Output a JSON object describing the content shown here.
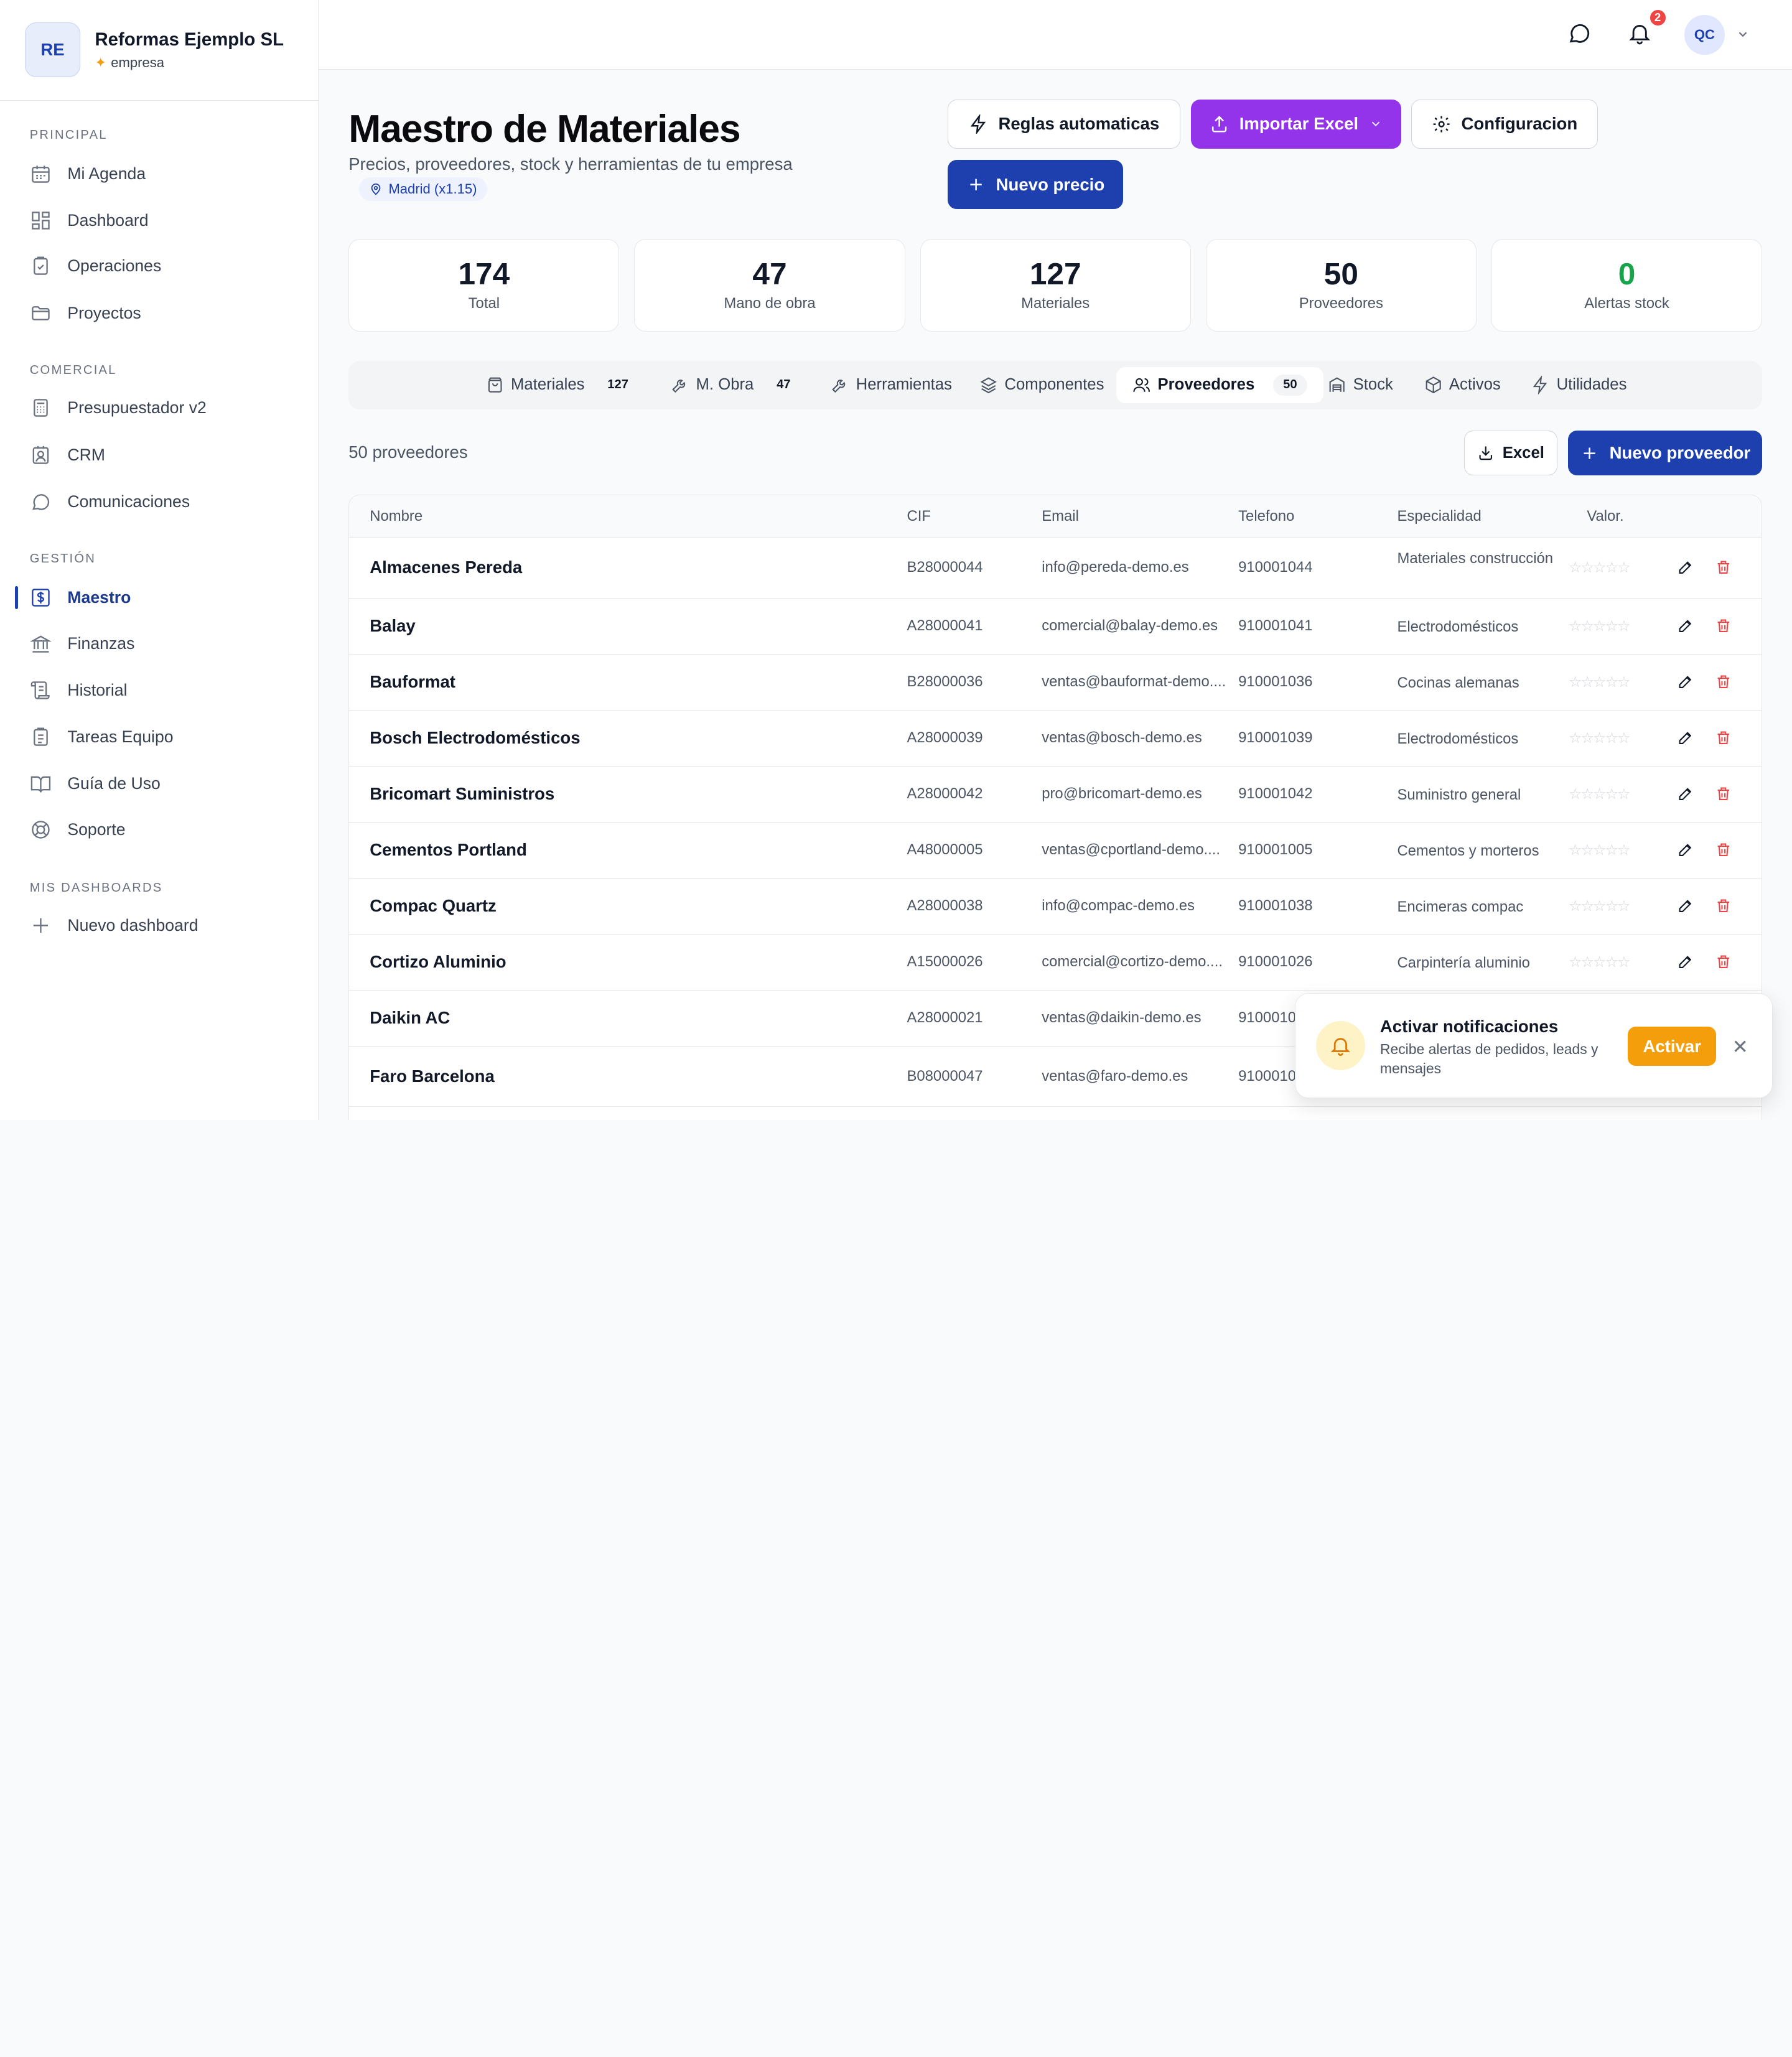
{
  "brand": {
    "initials": "RE",
    "name": "Reformas Ejemplo SL",
    "type": "empresa"
  },
  "sidebar": {
    "sections": [
      {
        "title": "PRINCIPAL",
        "items": [
          {
            "label": "Mi Agenda",
            "icon": "calendar-icon"
          },
          {
            "label": "Dashboard",
            "icon": "dashboard-icon"
          },
          {
            "label": "Operaciones",
            "icon": "clipboard-check-icon"
          },
          {
            "label": "Proyectos",
            "icon": "folder-icon"
          }
        ]
      },
      {
        "title": "COMERCIAL",
        "items": [
          {
            "label": "Presupuestador v2",
            "icon": "calculator-icon"
          },
          {
            "label": "CRM",
            "icon": "contact-icon"
          },
          {
            "label": "Comunicaciones",
            "icon": "message-icon"
          }
        ]
      },
      {
        "title": "GESTIÓN",
        "items": [
          {
            "label": "Maestro",
            "icon": "dollar-square-icon",
            "active": true
          },
          {
            "label": "Finanzas",
            "icon": "bank-icon"
          },
          {
            "label": "Historial",
            "icon": "scroll-icon"
          },
          {
            "label": "Tareas Equipo",
            "icon": "clipboard-list-icon"
          },
          {
            "label": "Guía de Uso",
            "icon": "book-icon"
          },
          {
            "label": "Soporte",
            "icon": "lifebuoy-icon"
          }
        ]
      },
      {
        "title": "MIS DASHBOARDS",
        "items": [
          {
            "label": "Nuevo dashboard",
            "icon": "plus-icon"
          }
        ]
      }
    ]
  },
  "topbar": {
    "notification_count": "2",
    "user_initials": "QC"
  },
  "page": {
    "title": "Maestro de Materiales",
    "subtitle": "Precios, proveedores, stock y herramientas de tu empresa",
    "region": "Madrid (x1.15)",
    "buttons": {
      "rules": "Reglas automaticas",
      "import": "Importar Excel",
      "config": "Configuracion",
      "new_price": "Nuevo precio"
    }
  },
  "stats": [
    {
      "value": "174",
      "label": "Total",
      "color": "#111827"
    },
    {
      "value": "47",
      "label": "Mano de obra",
      "color": "#111827"
    },
    {
      "value": "127",
      "label": "Materiales",
      "color": "#111827"
    },
    {
      "value": "50",
      "label": "Proveedores",
      "color": "#111827"
    },
    {
      "value": "0",
      "label": "Alertas stock",
      "color": "#16a34a"
    }
  ],
  "tabs": [
    {
      "label": "Materiales",
      "count": "127",
      "icon": "shopping-bag-icon"
    },
    {
      "label": "M. Obra",
      "count": "47",
      "icon": "wrench-icon"
    },
    {
      "label": "Herramientas",
      "count": "",
      "icon": "tool-icon"
    },
    {
      "label": "Componentes",
      "count": "",
      "icon": "layers-icon"
    },
    {
      "label": "Proveedores",
      "count": "50",
      "icon": "users-icon",
      "active": true
    },
    {
      "label": "Stock",
      "count": "",
      "icon": "warehouse-icon"
    },
    {
      "label": "Activos",
      "count": "",
      "icon": "box-icon"
    },
    {
      "label": "Utilidades",
      "count": "",
      "icon": "zap-icon"
    }
  ],
  "list": {
    "count_text": "50 proveedores",
    "excel_label": "Excel",
    "new_label": "Nuevo proveedor",
    "columns": [
      "Nombre",
      "CIF",
      "Email",
      "Telefono",
      "Especialidad",
      "Valor."
    ],
    "rows": [
      {
        "name": "Almacenes Pereda",
        "cif": "B28000044",
        "email": "info@pereda-demo.es",
        "phone": "910001044",
        "specialty": "Materiales construcción"
      },
      {
        "name": "Balay",
        "cif": "A28000041",
        "email": "comercial@balay-demo.es",
        "phone": "910001041",
        "specialty": "Electrodomésticos"
      },
      {
        "name": "Bauformat",
        "cif": "B28000036",
        "email": "ventas@bauformat-demo....",
        "phone": "910001036",
        "specialty": "Cocinas alemanas"
      },
      {
        "name": "Bosch Electrodomésticos",
        "cif": "A28000039",
        "email": "ventas@bosch-demo.es",
        "phone": "910001039",
        "specialty": "Electrodomésticos"
      },
      {
        "name": "Bricomart Suministros",
        "cif": "A28000042",
        "email": "pro@bricomart-demo.es",
        "phone": "910001042",
        "specialty": "Suministro general"
      },
      {
        "name": "Cementos Portland",
        "cif": "A48000005",
        "email": "ventas@cportland-demo....",
        "phone": "910001005",
        "specialty": "Cementos y morteros"
      },
      {
        "name": "Compac Quartz",
        "cif": "A28000038",
        "email": "info@compac-demo.es",
        "phone": "910001038",
        "specialty": "Encimeras compac"
      },
      {
        "name": "Cortizo Aluminio",
        "cif": "A15000026",
        "email": "comercial@cortizo-demo....",
        "phone": "910001026",
        "specialty": "Carpintería aluminio"
      },
      {
        "name": "Daikin AC",
        "cif": "A28000021",
        "email": "ventas@daikin-demo.es",
        "phone": "9100010",
        "specialty": ""
      },
      {
        "name": "Faro Barcelona",
        "cif": "B08000047",
        "email": "ventas@faro-demo.es",
        "phone": "9100010",
        "specialty": ""
      }
    ]
  },
  "toast": {
    "title": "Activar notificaciones",
    "text": "Recibe alertas de pedidos, leads y mensajes",
    "button": "Activar",
    "close": "✕"
  },
  "colors": {
    "accent": "#1e40af",
    "purple": "#9333ea",
    "amber": "#f59e0b",
    "danger": "#ef4444",
    "success": "#16a34a"
  }
}
